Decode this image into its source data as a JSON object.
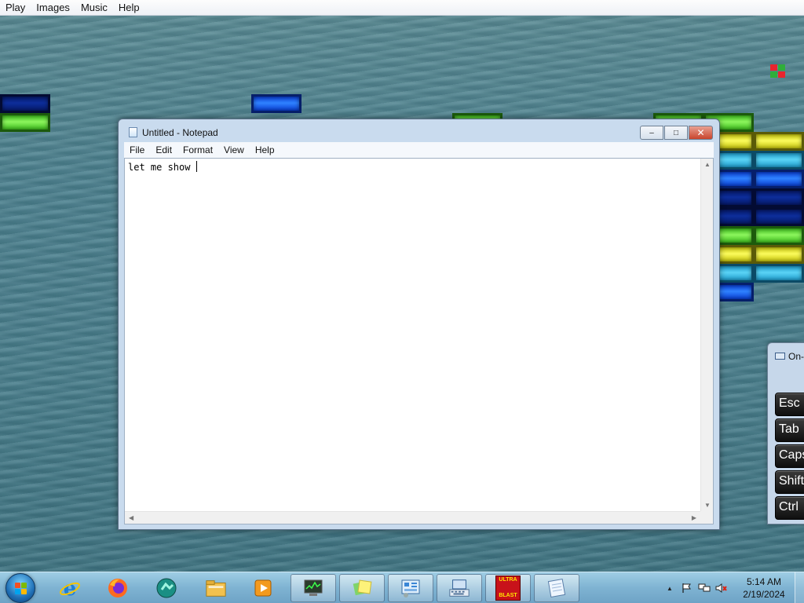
{
  "game": {
    "menu": [
      "Play",
      "Images",
      "Music",
      "Help"
    ]
  },
  "notepad": {
    "title": "Untitled - Notepad",
    "menu": [
      "File",
      "Edit",
      "Format",
      "View",
      "Help"
    ],
    "content": "let me show ",
    "controls": {
      "minimize": "–",
      "maximize": "□",
      "close": "✕"
    }
  },
  "osk": {
    "title": "On-",
    "keys": [
      "Esc",
      "Tab",
      "Caps",
      "Shift",
      "Ctrl"
    ]
  },
  "taskbar": {
    "pinned": [
      "internet-explorer",
      "firefox",
      "app-teal",
      "windows-explorer",
      "media-player"
    ],
    "running": [
      "task-manager",
      "sticky-notes",
      "control-panel",
      "on-screen-keyboard",
      "ultra-blast",
      "notepad"
    ],
    "ultra_blast_label": [
      "ULTRA",
      "BLAST"
    ],
    "clock": {
      "time": "5:14 AM",
      "date": "2/19/2024"
    },
    "tray_chevron": "▲"
  },
  "colors": {
    "green": "#6fe24a",
    "yellow": "#f3f040",
    "cyan": "#43c4ee",
    "blue": "#1f6bff",
    "navy": "#0a2488"
  }
}
